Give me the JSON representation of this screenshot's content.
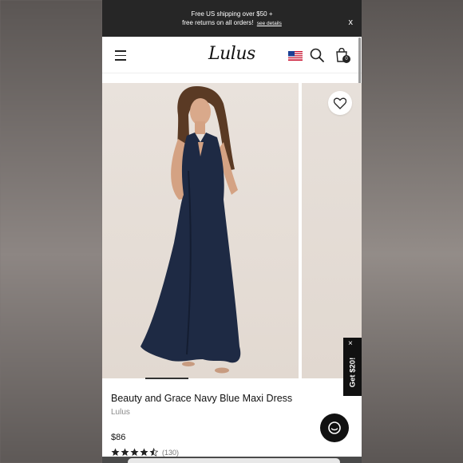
{
  "promo": {
    "line1": "Free US shipping over $50 +",
    "line2": "free returns on all orders!",
    "see_details": "see details",
    "close": "x"
  },
  "header": {
    "logo": "Lulus",
    "bag_count": "0",
    "icons": [
      "menu-icon",
      "us-flag-icon",
      "search-icon",
      "bag-icon"
    ]
  },
  "product": {
    "title": "Beauty and Grace Navy Blue Maxi Dress",
    "brand": "Lulus",
    "price": "$86",
    "rating": 4.5,
    "review_count": "(130)"
  },
  "widgets": {
    "get20_label": "Get $20!",
    "get20_close": "×"
  },
  "colors": {
    "promo_bg": "#262626",
    "dress_navy": "#1e2a44",
    "star": "#222222",
    "chat_bg": "#111111"
  }
}
